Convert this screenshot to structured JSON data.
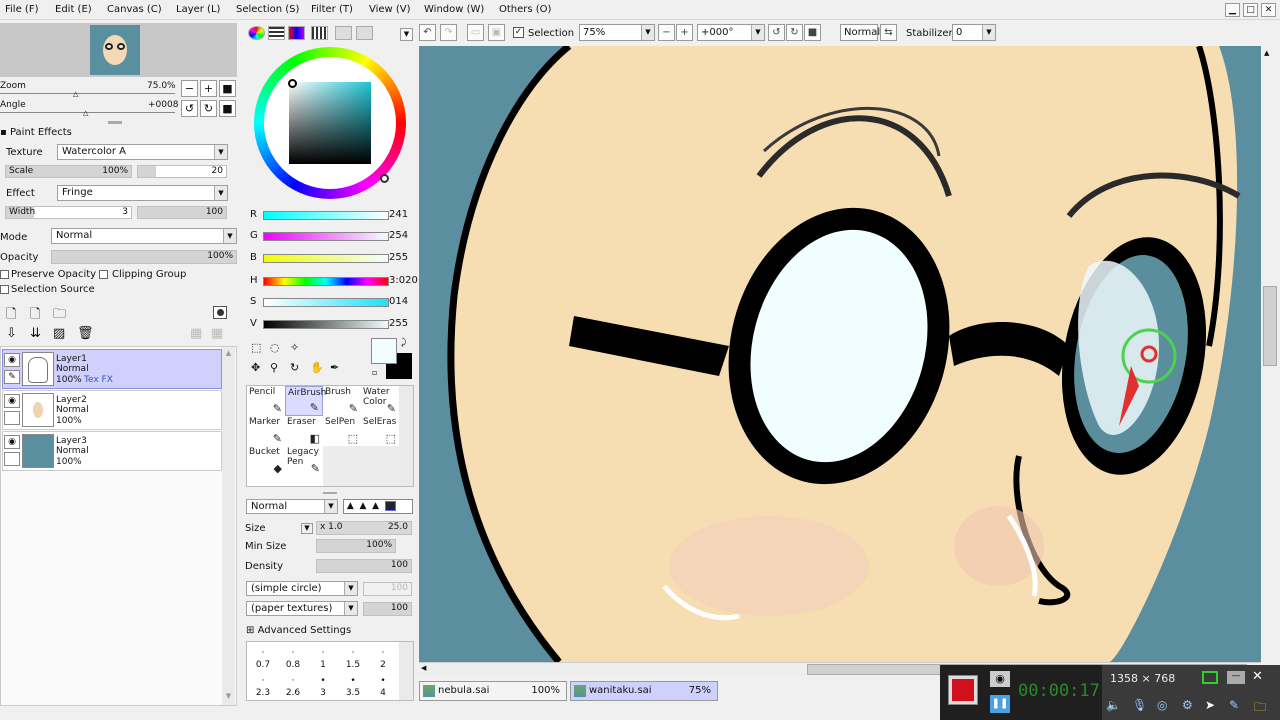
{
  "menu": [
    "File (F)",
    "Edit (E)",
    "Canvas (C)",
    "Layer (L)",
    "Selection (S)",
    "Filter (T)",
    "View (V)",
    "Window (W)",
    "Others (O)"
  ],
  "toolbar": {
    "selection_label": "Selection",
    "zoom_value": "75%",
    "angle_value": "+000°",
    "blend_mode": "Normal",
    "stabilizer_label": "Stabilizer",
    "stabilizer_value": "0"
  },
  "navigator": {
    "zoom_label": "Zoom",
    "zoom_value": "75.0%",
    "angle_label": "Angle",
    "angle_value": "+0008"
  },
  "paint_effects": {
    "header": "Paint Effects",
    "texture_label": "Texture",
    "texture_value": "Watercolor A",
    "scale_label": "Scale",
    "scale_value": "100%",
    "scale_num": "20",
    "effect_label": "Effect",
    "effect_value": "Fringe",
    "width_label": "Width",
    "width_value": "3",
    "width_num": "100"
  },
  "layer_props": {
    "mode_label": "Mode",
    "mode_value": "Normal",
    "opacity_label": "Opacity",
    "opacity_value": "100%",
    "preserve_opacity": "Preserve Opacity",
    "clipping_group": "Clipping Group",
    "selection_source": "Selection Source"
  },
  "layers": [
    {
      "name": "Layer1",
      "mode": "Normal",
      "opacity": "100%",
      "extra": "Tex FX"
    },
    {
      "name": "Layer2",
      "mode": "Normal",
      "opacity": "100%",
      "extra": ""
    },
    {
      "name": "Layer3",
      "mode": "Normal",
      "opacity": "100%",
      "extra": ""
    }
  ],
  "color": {
    "r_label": "R",
    "r_value": "241",
    "r_frac": 0.945,
    "g_label": "G",
    "g_value": "254",
    "g_frac": 0.996,
    "b_label": "B",
    "b_value": "255",
    "b_frac": 1.0,
    "h_label": "H",
    "h_value": "3:020",
    "s_label": "S",
    "s_value": "014",
    "v_label": "V",
    "v_value": "255",
    "current": "#f1feff",
    "secondary": "#000000"
  },
  "tools": [
    {
      "label": "Pencil",
      "label2": ""
    },
    {
      "label": "AirBrush",
      "label2": ""
    },
    {
      "label": "Brush",
      "label2": ""
    },
    {
      "label": "Water",
      "label2": "Color"
    },
    {
      "label": "Marker",
      "label2": ""
    },
    {
      "label": "Eraser",
      "label2": ""
    },
    {
      "label": "SelPen",
      "label2": ""
    },
    {
      "label": "SelEras",
      "label2": ""
    },
    {
      "label": "Bucket",
      "label2": ""
    },
    {
      "label": "Legacy",
      "label2": "Pen"
    }
  ],
  "brush": {
    "blend_mode": "Normal",
    "size_label": "Size",
    "size_mult": "x 1.0",
    "size_value": "25.0",
    "minsize_label": "Min Size",
    "minsize_value": "100%",
    "density_label": "Density",
    "density_value": "100",
    "shape": "(simple circle)",
    "shape_value": "100",
    "texture": "(paper textures)",
    "texture_value": "100",
    "advanced": "Advanced Settings",
    "sizes_row1": [
      "0.7",
      "0.8",
      "1",
      "1.5",
      "2"
    ],
    "sizes_row2": [
      "2.3",
      "2.6",
      "3",
      "3.5",
      "4"
    ]
  },
  "docs": [
    {
      "name": "nebula.sai",
      "zoom": "100%"
    },
    {
      "name": "wanitaku.sai",
      "zoom": "75%"
    }
  ],
  "recorder": {
    "timer": "00:00:17",
    "resolution": "1358 × 768"
  }
}
